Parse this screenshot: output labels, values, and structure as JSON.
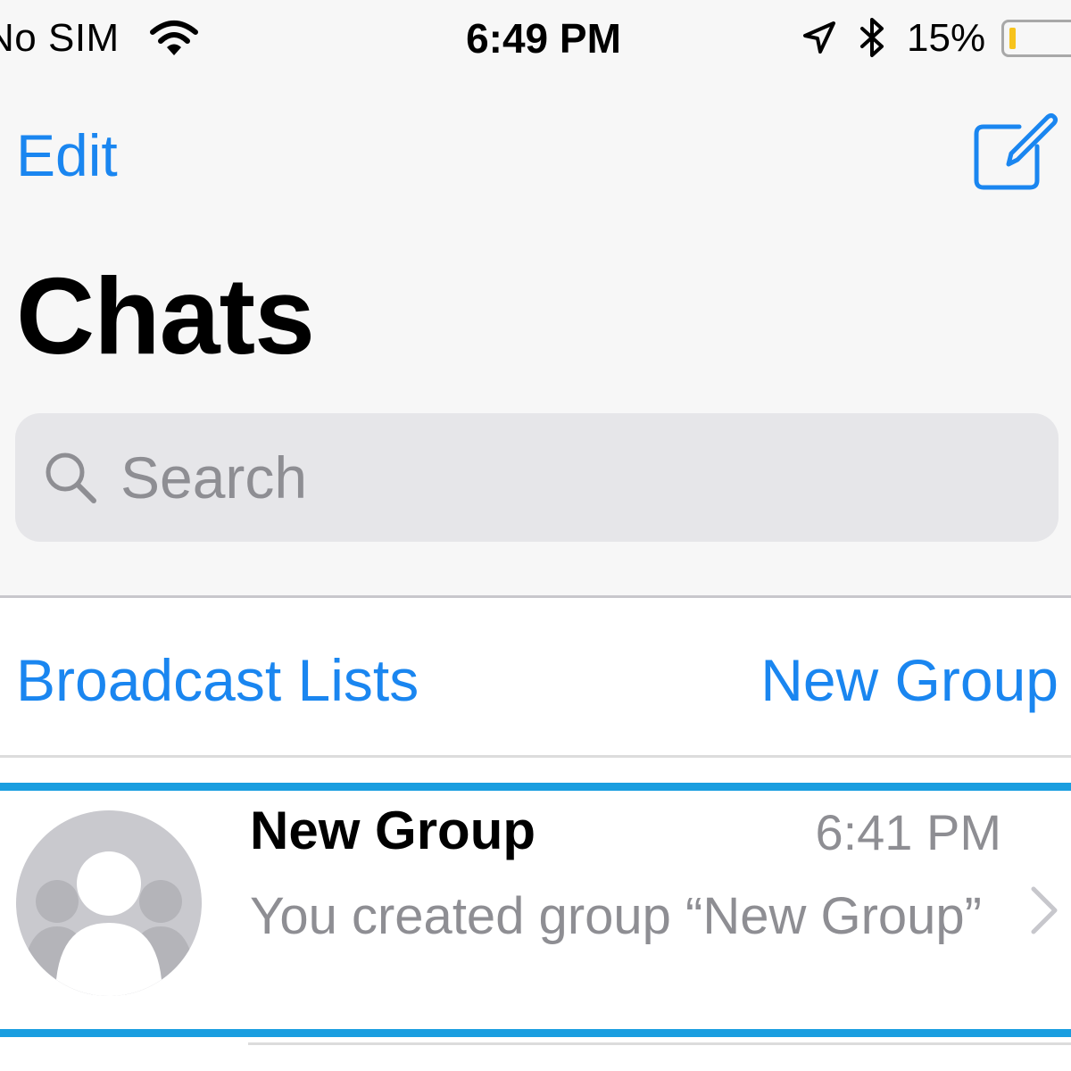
{
  "status_bar": {
    "carrier": "No SIM",
    "time": "6:49 PM",
    "battery_percent": "15%",
    "battery_level": 0.15,
    "icons": [
      "wifi-icon",
      "location-icon",
      "bluetooth-icon",
      "battery-icon"
    ]
  },
  "nav": {
    "edit_label": "Edit",
    "compose_icon": "compose-icon"
  },
  "page": {
    "title": "Chats"
  },
  "search": {
    "placeholder": "Search",
    "value": ""
  },
  "actions": {
    "broadcast_label": "Broadcast Lists",
    "new_group_label": "New Group"
  },
  "chats": [
    {
      "name": "New Group",
      "time": "6:41 PM",
      "preview": "You created group “New Group”",
      "avatar_icon": "group-avatar-icon"
    }
  ],
  "colors": {
    "accent": "#1a86f0",
    "selection_border": "#1a9ee0",
    "secondary_text": "#8e8e93",
    "battery_low": "#f7c31c"
  }
}
